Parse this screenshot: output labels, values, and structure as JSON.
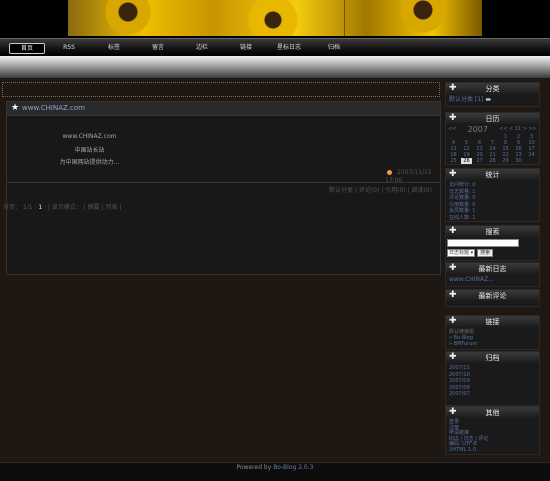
{
  "nav": {
    "items": [
      "首页",
      "RSS",
      "标签",
      "留言",
      "边栏",
      "链接",
      "星标日志",
      "归档"
    ]
  },
  "breadcrumb": "",
  "post": {
    "title": "www.CHINAZ.com",
    "lines": [
      "www.CHINAZ.com",
      "中国站长站",
      "为中国网站提供动力..."
    ],
    "date": "2007/11/15",
    "time": "17:00",
    "meta": "默认分类 | 评论(0) | 引用(0) | 阅读(0)"
  },
  "pager": {
    "label": "分页：",
    "pages": "1/1",
    "current": "1",
    "mode_label": "显示模式：",
    "modes": "摘要 | 列表"
  },
  "sidebar": {
    "category": {
      "title": "分类",
      "item": "默认分类 [1]"
    },
    "calendar": {
      "title": "日历",
      "year": "2007",
      "nav": "<< < 11 > >>",
      "weeks": [
        [
          "",
          "",
          "",
          "",
          "1",
          "2",
          "3"
        ],
        [
          "4",
          "5",
          "6",
          "7",
          "8",
          "9",
          "10"
        ],
        [
          "11",
          "12",
          "13",
          "14",
          "15",
          "16",
          "17"
        ],
        [
          "18",
          "19",
          "20",
          "21",
          "22",
          "23",
          "24"
        ],
        [
          "25",
          "26",
          "27",
          "28",
          "29",
          "30",
          ""
        ]
      ],
      "today": "26"
    },
    "stats": {
      "title": "统计",
      "items": [
        "访问统计: 0",
        "日志数量: 1",
        "评论数量: 0",
        "引用数量: 0",
        "会员数量: 1",
        "在线人数: 1"
      ]
    },
    "search": {
      "title": "搜索",
      "select": "日志标题",
      "button": "搜索"
    },
    "recent_posts": {
      "title": "最新日志",
      "items": [
        "www.CHINAZ..."
      ]
    },
    "recent_comments": {
      "title": "最新评论",
      "items": []
    },
    "links": {
      "title": "链接",
      "category": "默认链接组",
      "items": [
        "Bo-Blog",
        "BMForum"
      ]
    },
    "archive": {
      "title": "归档",
      "items": [
        "2007/11",
        "2007/10",
        "2007/09",
        "2007/08",
        "2007/07"
      ]
    },
    "other": {
      "title": "其他",
      "items": [
        "登录",
        "注册",
        "申请链接",
        "RSS | 日志 | 评论",
        "编码: UTF-8",
        "XHTML 1.0"
      ]
    }
  },
  "footer": {
    "prefix": "Powered by ",
    "link": "Bo-Blog 2.0.3"
  }
}
